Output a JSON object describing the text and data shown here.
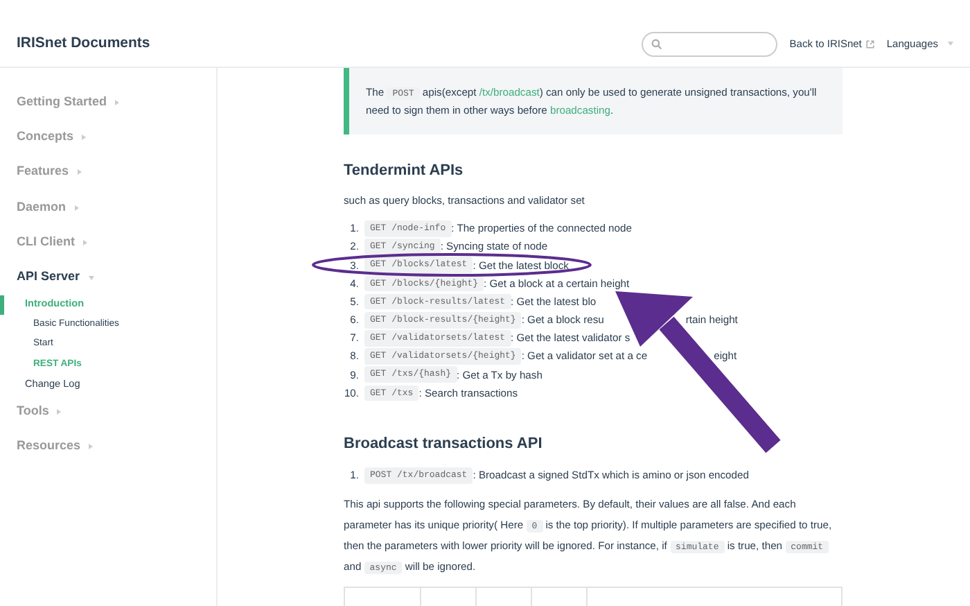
{
  "header": {
    "title": "IRISnet Documents",
    "links": [
      {
        "text": "Back to IRISnet",
        "kind": "external"
      },
      {
        "text": "Languages",
        "kind": "dropdown"
      }
    ]
  },
  "sidebar": {
    "groups": [
      {
        "label": "Getting Started",
        "expanded": false
      },
      {
        "label": "Concepts",
        "expanded": false
      },
      {
        "label": "Features",
        "expanded": false
      },
      {
        "label": "Daemon",
        "expanded": false
      },
      {
        "label": "CLI Client",
        "expanded": false
      },
      {
        "label": "API Server",
        "expanded": true,
        "children": [
          {
            "label": "Introduction",
            "selected": true,
            "children": [
              {
                "label": "Basic Functionalities",
                "selected": false
              },
              {
                "label": "Start",
                "selected": false
              },
              {
                "label": "REST APIs",
                "selected": true
              }
            ]
          },
          {
            "label": "Change Log",
            "selected": false
          }
        ]
      },
      {
        "label": "Tools",
        "expanded": false
      },
      {
        "label": "Resources",
        "expanded": false
      }
    ]
  },
  "note": {
    "segments": [
      {
        "kind": "text",
        "text": "The "
      },
      {
        "kind": "code",
        "text": "POST"
      },
      {
        "kind": "text",
        "text": " apis(except "
      },
      {
        "kind": "link",
        "text": "/tx/broadcast"
      },
      {
        "kind": "text",
        "text": ") can only be used to generate unsigned transactions, you'll need to sign them in other ways before "
      },
      {
        "kind": "link",
        "text": "broadcasting"
      },
      {
        "kind": "text",
        "text": "."
      }
    ]
  },
  "tendermint": {
    "heading": "Tendermint APIs",
    "intro": "such as query blocks, transactions and validator set",
    "items": [
      {
        "number": "1.",
        "code": "GET /node-info",
        "parts": [
          " : The properties of the connected node"
        ]
      },
      {
        "number": "2.",
        "code": "GET /syncing",
        "parts": [
          " : Syncing state of node"
        ]
      },
      {
        "number": "3.",
        "code": "GET /blocks/latest",
        "parts": [
          " : Get the latest block"
        ]
      },
      {
        "number": "4.",
        "code": "GET /blocks/{height}",
        "parts": [
          " : Get a block at a certain height"
        ]
      },
      {
        "number": "5.",
        "code": "GET /block-results/latest",
        "parts": [
          " : Get the latest blo"
        ]
      },
      {
        "number": "6.",
        "code": "GET /block-results/{height}",
        "parts": [
          " : Get a block resu",
          "rtain height"
        ]
      },
      {
        "number": "7.",
        "code": "GET /validatorsets/latest",
        "parts": [
          " : Get the latest validator s"
        ]
      },
      {
        "number": "8.",
        "code": "GET /validatorsets/{height}",
        "parts": [
          " : Get a validator set at a ce",
          "eight"
        ]
      },
      {
        "number": "9.",
        "code": "GET /txs/{hash}",
        "parts": [
          " : Get a Tx by hash"
        ]
      },
      {
        "number": "10.",
        "code": "GET /txs",
        "parts": [
          " : Search transactions"
        ]
      }
    ]
  },
  "broadcast": {
    "heading": "Broadcast transactions API",
    "items": [
      {
        "number": "1.",
        "code": "POST /tx/broadcast",
        "parts": [
          " : Broadcast a signed StdTx which is amino or json encoded"
        ]
      }
    ],
    "paragraph": [
      {
        "kind": "text",
        "text": "This api supports the following special parameters. By default, their values are all false. And each parameter has its unique priority( Here "
      },
      {
        "kind": "code",
        "text": "0"
      },
      {
        "kind": "text",
        "text": " is the top priority). If multiple parameters are specified to true, then the parameters with lower priority will be ignored. For instance, if "
      },
      {
        "kind": "code",
        "text": "simulate"
      },
      {
        "kind": "text",
        "text": " is true, then "
      },
      {
        "kind": "code",
        "text": "commit"
      },
      {
        "kind": "text",
        "text": " and "
      },
      {
        "kind": "code",
        "text": "async"
      },
      {
        "kind": "text",
        "text": " will be ignored."
      }
    ]
  }
}
